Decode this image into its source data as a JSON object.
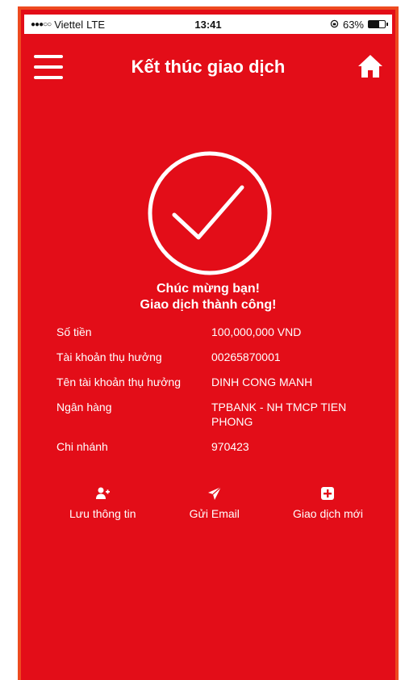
{
  "status_bar": {
    "signal": "●●●○○",
    "carrier": "Viettel",
    "network": "LTE",
    "time": "13:41",
    "battery_text": "63%",
    "battery_level": 0.63
  },
  "header": {
    "title": "Kết thúc giao dịch",
    "menu_icon": "menu-icon",
    "home_icon": "home-icon"
  },
  "success": {
    "icon": "check-circle-icon",
    "line1": "Chúc mừng bạn!",
    "line2": "Giao dịch thành công!"
  },
  "details": [
    {
      "label": "Số tiền",
      "value": "100,000,000 VND"
    },
    {
      "label": "Tài khoản thụ hưởng",
      "value": "00265870001"
    },
    {
      "label": "Tên tài khoản thụ hưởng",
      "value": "DINH CONG MANH"
    },
    {
      "label": "Ngân hàng",
      "value": "TPBANK - NH TMCP TIEN PHONG"
    },
    {
      "label": "Chi nhánh",
      "value": "970423"
    }
  ],
  "actions": [
    {
      "label": "Lưu thông tin",
      "icon": "add-user-icon"
    },
    {
      "label": "Gửi Email",
      "icon": "send-icon"
    },
    {
      "label": "Giao dịch mới",
      "icon": "plus-square-icon"
    }
  ],
  "colors": {
    "background": "#e30d18",
    "border": "#ee4a1f",
    "text": "#ffffff"
  }
}
